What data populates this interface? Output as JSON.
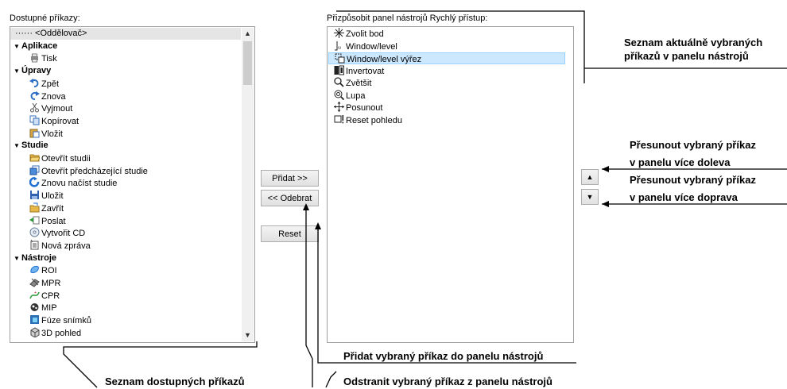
{
  "left_panel": {
    "label": "Dostupné příkazy:",
    "rows": [
      {
        "text": "······ <Oddělovač>",
        "icon": "separator-icon"
      },
      {
        "text": "Aplikace",
        "icon": "expand-icon"
      },
      {
        "text": "Tisk",
        "icon": "printer-icon"
      },
      {
        "text": "Úpravy",
        "icon": "expand-icon"
      },
      {
        "text": "Zpět",
        "icon": "undo-icon"
      },
      {
        "text": "Znova",
        "icon": "redo-icon"
      },
      {
        "text": "Vyjmout",
        "icon": "scissors-icon"
      },
      {
        "text": "Kopírovat",
        "icon": "copy-icon"
      },
      {
        "text": "Vložit",
        "icon": "paste-icon"
      },
      {
        "text": "Studie",
        "icon": "expand-icon"
      },
      {
        "text": "Otevřít studii",
        "icon": "folder-open-icon"
      },
      {
        "text": "Otevřít předcházející studie",
        "icon": "previous-studies-icon"
      },
      {
        "text": "Znovu načíst studie",
        "icon": "reload-icon"
      },
      {
        "text": "Uložit",
        "icon": "save-icon"
      },
      {
        "text": "Zavřít",
        "icon": "close-folder-icon"
      },
      {
        "text": "Poslat",
        "icon": "send-icon"
      },
      {
        "text": "Vytvořit CD",
        "icon": "cd-icon"
      },
      {
        "text": "Nová zpráva",
        "icon": "new-report-icon"
      },
      {
        "text": "Nástroje",
        "icon": "expand-icon"
      },
      {
        "text": "ROI",
        "icon": "roi-icon"
      },
      {
        "text": "MPR",
        "icon": "mpr-icon"
      },
      {
        "text": "CPR",
        "icon": "cpr-icon"
      },
      {
        "text": "MIP",
        "icon": "mip-icon"
      },
      {
        "text": "Fúze snímků",
        "icon": "fusion-icon"
      },
      {
        "text": "3D pohled",
        "icon": "cube-icon"
      }
    ]
  },
  "right_panel": {
    "label": "Přizpůsobit panel nástrojů Rychlý přístup:",
    "rows": [
      {
        "text": "Zvolit bod",
        "icon": "crosshair-icon"
      },
      {
        "text": "Window/level",
        "icon": "window-level-icon"
      },
      {
        "text": "Window/level výřez",
        "icon": "window-level-roi-icon"
      },
      {
        "text": "Invertovat",
        "icon": "invert-icon"
      },
      {
        "text": "Zvětšit",
        "icon": "zoom-icon"
      },
      {
        "text": "Lupa",
        "icon": "magnifier-icon"
      },
      {
        "text": "Posunout",
        "icon": "pan-icon"
      },
      {
        "text": "Reset pohledu",
        "icon": "reset-view-icon"
      }
    ]
  },
  "buttons": {
    "add": "Přidat >>",
    "remove": "<< Odebrat",
    "reset": "Reset"
  },
  "annotations": {
    "selected_list_1": "Seznam aktuálně vybraných",
    "selected_list_2": "příkazů v panelu nástrojů",
    "move_left_1": "Přesunout vybraný příkaz",
    "move_left_2": "v panelu více doleva",
    "move_right_1": "Přesunout vybraný příkaz",
    "move_right_2": "v panelu více doprava",
    "add_cmd": "Přidat vybraný příkaz do panelu nástrojů",
    "remove_cmd": "Odstranit vybraný příkaz z panelu nástrojů",
    "available_list": "Seznam dostupných příkazů"
  }
}
